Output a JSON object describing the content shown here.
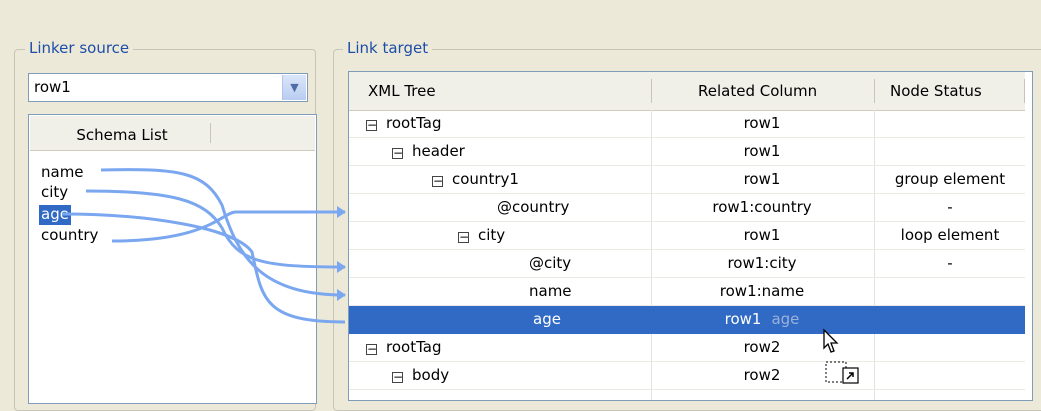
{
  "linker_source": {
    "title": "Linker source",
    "combo_value": "row1",
    "schema_header": "Schema List",
    "items": [
      "name",
      "city",
      "age",
      "country"
    ]
  },
  "link_target": {
    "title": "Link target",
    "columns": [
      "XML Tree",
      "Related Column",
      "Node Status"
    ],
    "rows": [
      {
        "node": "rootTag",
        "related": "row1",
        "status": ""
      },
      {
        "node": "header",
        "related": "row1",
        "status": ""
      },
      {
        "node": "country1",
        "related": "row1",
        "status": "group element"
      },
      {
        "node": "@country",
        "related": "row1:country",
        "status": "-"
      },
      {
        "node": "city",
        "related": "row1",
        "status": "loop element"
      },
      {
        "node": "@city",
        "related": "row1:city",
        "status": "-"
      },
      {
        "node": "name",
        "related": "row1:name",
        "status": ""
      },
      {
        "node": "age",
        "related": "row1",
        "status": "",
        "drag_label": "age"
      },
      {
        "node": "rootTag",
        "related": "row2",
        "status": ""
      },
      {
        "node": "body",
        "related": "row2",
        "status": ""
      }
    ]
  },
  "colors": {
    "selection": "#316ac5",
    "link_line": "#7aa7ef",
    "group_title": "#1d4ea8"
  },
  "icons": [
    "chevron-down-icon",
    "collapse-toggle-icon",
    "drag-cursor-icon",
    "link-shortcut-icon"
  ]
}
